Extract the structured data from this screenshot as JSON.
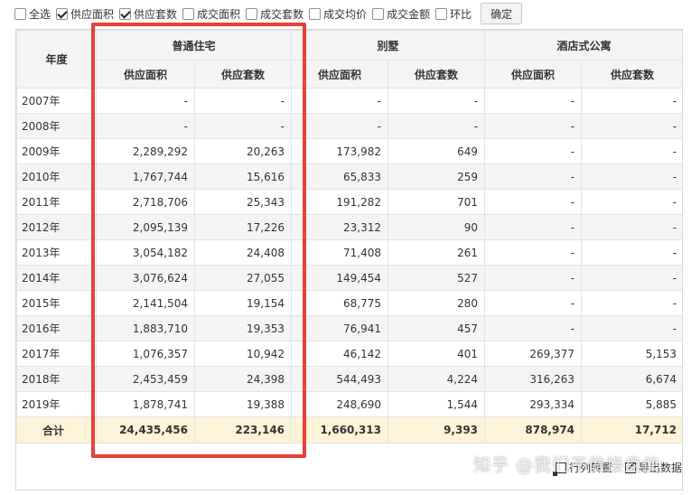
{
  "filters": [
    {
      "label": "全选",
      "checked": false
    },
    {
      "label": "供应面积",
      "checked": true
    },
    {
      "label": "供应套数",
      "checked": true
    },
    {
      "label": "成交面积",
      "checked": false
    },
    {
      "label": "成交套数",
      "checked": false
    },
    {
      "label": "成交均价",
      "checked": false
    },
    {
      "label": "成交金额",
      "checked": false
    },
    {
      "label": "环比",
      "checked": false
    }
  ],
  "confirm_label": "确定",
  "table": {
    "year_header": "年度",
    "groups": [
      "普通住宅",
      "别墅",
      "酒店式公寓"
    ],
    "subheaders": [
      "供应面积",
      "供应套数"
    ],
    "rows": [
      {
        "year": "2007年",
        "cells": [
          "-",
          "-",
          "-",
          "-",
          "-",
          "-"
        ]
      },
      {
        "year": "2008年",
        "cells": [
          "-",
          "-",
          "-",
          "-",
          "-",
          "-"
        ]
      },
      {
        "year": "2009年",
        "cells": [
          "2,289,292",
          "20,263",
          "173,982",
          "649",
          "-",
          "-"
        ]
      },
      {
        "year": "2010年",
        "cells": [
          "1,767,744",
          "15,616",
          "65,833",
          "259",
          "-",
          "-"
        ]
      },
      {
        "year": "2011年",
        "cells": [
          "2,718,706",
          "25,343",
          "191,282",
          "701",
          "-",
          "-"
        ]
      },
      {
        "year": "2012年",
        "cells": [
          "2,095,139",
          "17,226",
          "23,312",
          "90",
          "-",
          "-"
        ]
      },
      {
        "year": "2013年",
        "cells": [
          "3,054,182",
          "24,408",
          "71,408",
          "261",
          "-",
          "-"
        ]
      },
      {
        "year": "2014年",
        "cells": [
          "3,076,624",
          "27,055",
          "149,454",
          "527",
          "-",
          "-"
        ]
      },
      {
        "year": "2015年",
        "cells": [
          "2,141,504",
          "19,154",
          "68,775",
          "280",
          "-",
          "-"
        ]
      },
      {
        "year": "2016年",
        "cells": [
          "1,883,710",
          "19,353",
          "76,941",
          "457",
          "-",
          "-"
        ]
      },
      {
        "year": "2017年",
        "cells": [
          "1,076,357",
          "10,942",
          "46,142",
          "401",
          "269,377",
          "5,153"
        ]
      },
      {
        "year": "2018年",
        "cells": [
          "2,453,459",
          "24,398",
          "544,493",
          "4,224",
          "316,263",
          "6,674"
        ]
      },
      {
        "year": "2019年",
        "cells": [
          "1,878,741",
          "19,388",
          "248,690",
          "1,544",
          "293,334",
          "5,885"
        ]
      }
    ],
    "total": {
      "year": "合计",
      "cells": [
        "24,435,456",
        "223,146",
        "1,660,313",
        "9,393",
        "878,974",
        "17,712"
      ]
    }
  },
  "tools": {
    "swap_label": "行列转置",
    "export_label": "导出数据"
  },
  "watermark": "知乎 @我们不做接盘侠",
  "highlight_color": "#e8413a"
}
